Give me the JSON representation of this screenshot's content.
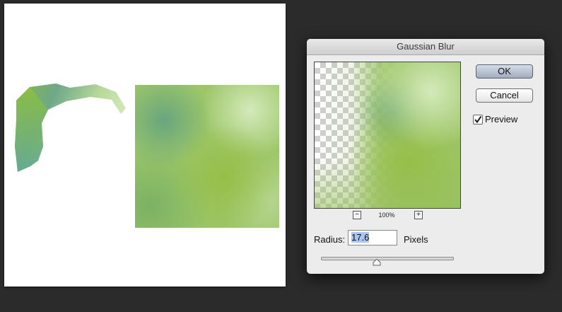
{
  "dialog": {
    "title": "Gaussian Blur",
    "ok_label": "OK",
    "cancel_label": "Cancel",
    "preview_label": "Preview",
    "preview_checked": true,
    "zoom_minus": "−",
    "zoom_plus": "+",
    "zoom_level": "100%",
    "radius_label": "Radius:",
    "radius_value": "17.6",
    "units_label": "Pixels",
    "slider_value": 17.6
  },
  "icons": {
    "zoom_out": "zoom-out-icon",
    "zoom_in": "zoom-in-icon",
    "checkmark": "checkmark-icon",
    "slider_thumb": "slider-thumb-icon"
  },
  "colors": {
    "background": "#2b2b2b",
    "canvas": "#ffffff",
    "dialog": "#ececec",
    "ok_button": "#b8c3d3",
    "selection": "#a8c8f0",
    "artwork_green": "#9cc668"
  }
}
